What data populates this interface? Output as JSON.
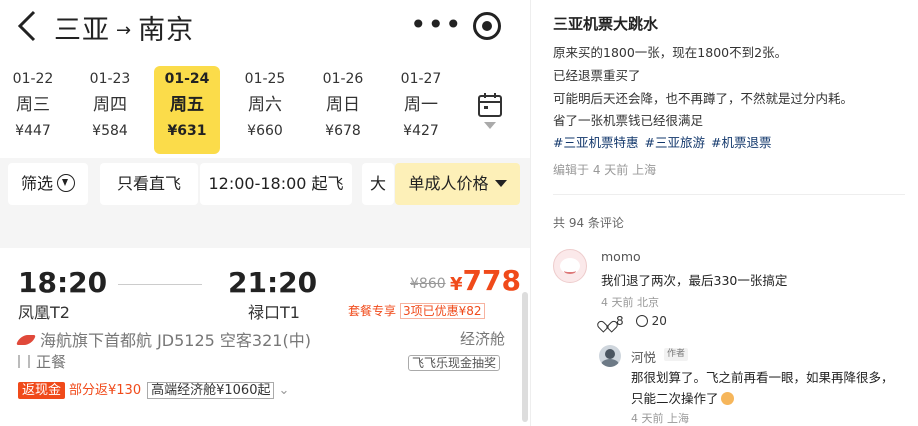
{
  "app": {
    "route": {
      "from": "三亚",
      "arrow": "→",
      "to": "南京"
    },
    "capsule": {
      "more": "•••"
    },
    "dates": [
      {
        "date": "01-22",
        "week": "周三",
        "price": "¥447",
        "selected": false
      },
      {
        "date": "01-23",
        "week": "周四",
        "price": "¥584",
        "selected": false
      },
      {
        "date": "01-24",
        "week": "周五",
        "price": "¥631",
        "selected": true
      },
      {
        "date": "01-25",
        "week": "周六",
        "price": "¥660",
        "selected": false
      },
      {
        "date": "01-26",
        "week": "周日",
        "price": "¥678",
        "selected": false
      },
      {
        "date": "01-27",
        "week": "周一",
        "price": "¥427",
        "selected": false
      }
    ],
    "filters": {
      "filter": "筛选",
      "direct": "只看直飞",
      "time": "12:00-18:00 起飞",
      "truncated": "大",
      "price_mode": "单成人价格"
    },
    "flight": {
      "dep_time": "18:20",
      "dep_airport": "凤凰T2",
      "arr_time": "21:20",
      "arr_airport": "禄口T1",
      "old_price": "¥860",
      "yen": "¥",
      "price": "778",
      "package_label": "套餐专享",
      "discount": "3项已优惠¥82",
      "airline": "海航旗下首都航 JD5125  空客321(中)",
      "cabin": "经济舱",
      "meal": "正餐",
      "lottery": "飞飞乐现金抽奖",
      "cashback_tag": "返现金",
      "cashback_part": "部分返¥130",
      "premium_econ": "高端经济舱¥1060起",
      "chevron": "⌄"
    }
  },
  "post": {
    "title": "三亚机票大跳水",
    "lines": [
      "原来买的1800一张，现在1800不到2张。",
      "已经退票重买了",
      "可能明后天还会降，也不再蹲了，不然就是过分内耗。",
      "省了一张机票钱已经很满足"
    ],
    "tags": [
      "#三亚机票特惠",
      "#三亚旅游",
      "#机票退票"
    ],
    "edited": "编辑于 4 天前 上海",
    "comment_count": "共 94 条评论",
    "comments": [
      {
        "name": "momo",
        "text": "我们退了两次，最后330一张搞定",
        "meta": "4 天前 北京",
        "likes": "8",
        "replies": "20"
      }
    ],
    "reply": {
      "name": "河悦",
      "badge": "作者",
      "text_line1": "那很划算了。飞之前再看一眼，如果再降很多，",
      "text_line2": "只能二次操作了",
      "meta": "4 天前 上海"
    }
  }
}
